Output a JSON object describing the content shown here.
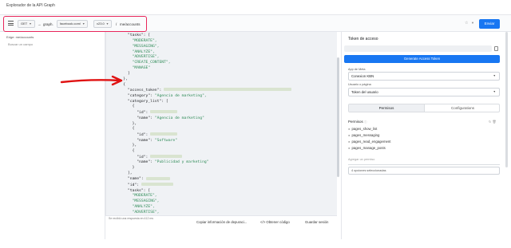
{
  "app": {
    "title": "Explorador de la API Graph"
  },
  "toolbar": {
    "method": "GET",
    "protocol": "https://",
    "host": "graph.facebook.com/",
    "host_prefix": "graph.",
    "host_domain": "facebook.com/",
    "version": "v23.0",
    "path": "me/accounts",
    "path_sep": "/",
    "submit_label": "Enviar"
  },
  "sidebar": {
    "label": "Edge: me/accounts",
    "search_placeholder": "Buscar un campo"
  },
  "editor": {
    "lines": [
      {
        "pre": "      \"tasks\": ["
      },
      {
        "pre": "        ",
        "s": "\"MODERATE\","
      },
      {
        "pre": "        ",
        "s": "\"MESSAGING\","
      },
      {
        "pre": "        ",
        "s": "\"ANALYZE\","
      },
      {
        "pre": "        ",
        "s": "\"ADVERTISE\","
      },
      {
        "pre": "        ",
        "s": "\"CREATE_CONTENT\","
      },
      {
        "pre": "        ",
        "s": "\"MANAGE\""
      },
      {
        "pre": "      ]"
      },
      {
        "pre": "    },"
      },
      {
        "pre": "    {"
      },
      {
        "pre": "      \"access_token\": ",
        "blur": 160
      },
      {
        "pre": "      \"category\": ",
        "s": "\"Agencia de marketing\","
      },
      {
        "pre": "      \"category_list\": ["
      },
      {
        "pre": "        {"
      },
      {
        "pre": "          \"id\": ",
        "blur": 34
      },
      {
        "pre": "          \"name\": ",
        "s": "\"Agencia de marketing\""
      },
      {
        "pre": "        },"
      },
      {
        "pre": "        {"
      },
      {
        "pre": "          \"id\": ",
        "blur": 34
      },
      {
        "pre": "          \"name\": ",
        "s": "\"Software\""
      },
      {
        "pre": "        },"
      },
      {
        "pre": "        {"
      },
      {
        "pre": "          \"id\": ",
        "blur": 40
      },
      {
        "pre": "          \"name\": ",
        "s": "\"Publicidad y marketing\""
      },
      {
        "pre": "        }"
      },
      {
        "pre": "      ],"
      },
      {
        "pre": "      \"name\": ",
        "blur": 30
      },
      {
        "pre": "      \"id\": ",
        "blur": 40
      },
      {
        "pre": "      \"tasks\": ["
      },
      {
        "pre": "        ",
        "s": "\"MODERATE\","
      },
      {
        "pre": "        ",
        "s": "\"MESSAGING\","
      },
      {
        "pre": "        ",
        "s": "\"ANALYZE\","
      },
      {
        "pre": "        ",
        "s": "\"ADVERTISE\","
      },
      {
        "pre": "        ",
        "s": "\"CREATE_CONTENT\","
      },
      {
        "pre": "        ",
        "s": "\"MANAGE\""
      },
      {
        "pre": "      ]"
      },
      {
        "pre": "    },"
      },
      {
        "pre": "    {"
      },
      {
        "pre": "      \"access_token\": ",
        "blur": 160
      }
    ],
    "footer_note": "Se recibió una respuesta en 412 ms",
    "copy_debug_label": "Copiar información de depuraci...",
    "get_code_label": "Obtener código",
    "save_session_label": "Guardar sesión"
  },
  "right_panel": {
    "token_heading": "Token de acceso",
    "generate_label": "Generate Access Token",
    "meta_app_label": "App de Meta",
    "meta_app_value": "Conexion KBN",
    "user_page_label": "Usuario o página",
    "user_page_value": "Token del usuario",
    "tab_permissions": "Permisos",
    "tab_settings": "Configurations",
    "permissions_heading": "Permisos",
    "permissions": [
      "pages_show_list",
      "pages_messaging",
      "pages_read_engagement",
      "pages_manage_posts"
    ],
    "add_permission_placeholder": "Agregar un permiso",
    "options_selected": "4 opciones seleccionadas"
  },
  "colors": {
    "accent": "#1877f2",
    "highlight": "#e8265b",
    "json_string": "#2e8b57"
  }
}
